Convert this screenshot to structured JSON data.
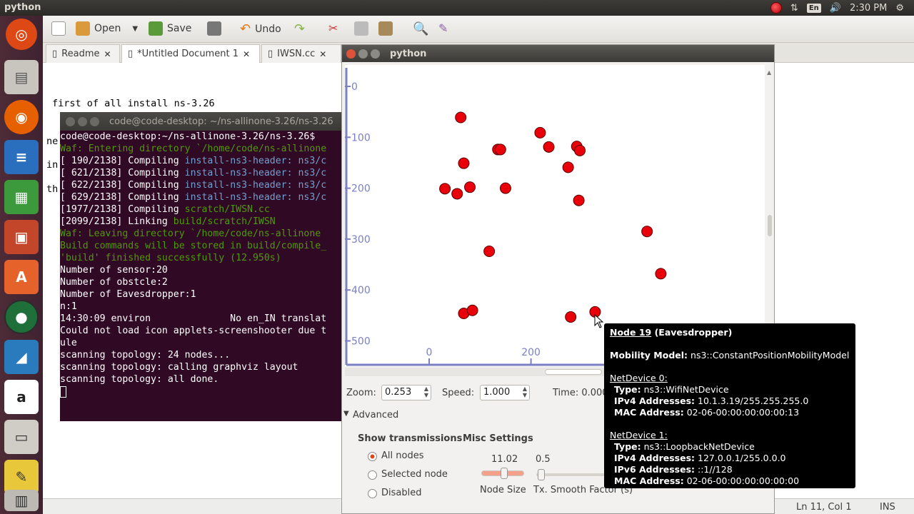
{
  "topbar": {
    "app_title": "python",
    "clock": "2:30 PM",
    "lang": "En"
  },
  "gedit": {
    "toolbar": {
      "open": "Open",
      "save": "Save",
      "undo": "Undo"
    },
    "tabs": [
      "Readme",
      "*Untitled Document 1",
      "IWSN.cc"
    ],
    "editor_lines": [
      "first of all install  ns-3.26",
      "ne",
      "in",
      "th"
    ],
    "status": {
      "position": "Ln 11, Col 1",
      "mode": "INS"
    }
  },
  "terminal": {
    "title": "code@code-desktop: ~/ns-allinone-3.26/ns-3.26",
    "lines": [
      [
        {
          "t": "code@code-desktop:~/ns-allinone-3.26/ns-3.26$ ",
          "c": "w"
        }
      ],
      [
        {
          "t": "Waf: Entering directory `/home/code/ns-allinone",
          "c": "g"
        }
      ],
      [
        {
          "t": "[ 190/2138] Compiling ",
          "c": "w"
        },
        {
          "t": "install-ns3-header: ns3/c",
          "c": "c"
        }
      ],
      [
        {
          "t": "[ 621/2138] Compiling ",
          "c": "w"
        },
        {
          "t": "install-ns3-header: ns3/c",
          "c": "c"
        }
      ],
      [
        {
          "t": "[ 622/2138] Compiling ",
          "c": "w"
        },
        {
          "t": "install-ns3-header: ns3/c",
          "c": "c"
        }
      ],
      [
        {
          "t": "[ 629/2138] Compiling ",
          "c": "w"
        },
        {
          "t": "install-ns3-header: ns3/c",
          "c": "c"
        }
      ],
      [
        {
          "t": "[1977/2138] Compiling ",
          "c": "w"
        },
        {
          "t": "scratch/IWSN.cc",
          "c": "g"
        }
      ],
      [
        {
          "t": "[2099/2138] Linking ",
          "c": "w"
        },
        {
          "t": "build/scratch/IWSN",
          "c": "g"
        }
      ],
      [
        {
          "t": "Waf: Leaving directory `/home/code/ns-allinone",
          "c": "g"
        }
      ],
      [
        {
          "t": "Build commands will be stored in build/compile_",
          "c": "g"
        }
      ],
      [
        {
          "t": "'build' finished successfully (12.950s)",
          "c": "g"
        }
      ],
      [
        {
          "t": "Number of sensor:20",
          "c": "w"
        }
      ],
      [
        {
          "t": "Number of obstcle:2",
          "c": "w"
        }
      ],
      [
        {
          "t": "Number of Eavesdropper:1",
          "c": "w"
        }
      ],
      [
        {
          "t": "n:1",
          "c": "w"
        }
      ],
      [
        {
          "t": "14:30:09 environ              No en_IN translat",
          "c": "w"
        }
      ],
      [
        {
          "t": "Could not load icon applets-screenshooter due t",
          "c": "w"
        }
      ],
      [
        {
          "t": "ule",
          "c": "w"
        }
      ],
      [
        {
          "t": "scanning topology: 24 nodes...",
          "c": "w"
        }
      ],
      [
        {
          "t": "scanning topology: calling graphviz layout",
          "c": "w"
        }
      ],
      [
        {
          "t": "scanning topology: all done.",
          "c": "w"
        }
      ]
    ]
  },
  "python_window": {
    "title": "python",
    "zoom_label": "Zoom:",
    "zoom_value": "0.253",
    "speed_label": "Speed:",
    "speed_value": "1.000",
    "time_label": "Time: 0.000",
    "advanced": "Advanced",
    "show_transmissions": "Show transmissions",
    "misc_settings": "Misc Settings",
    "radio": [
      "All nodes",
      "Selected node",
      "Disabled"
    ],
    "node_size_value": "11.02",
    "node_size_label": "Node Size",
    "smooth_value": "0.5",
    "smooth_label": "Tx. Smooth Factor (s)"
  },
  "chart_data": {
    "type": "scatter",
    "x_ticks": [
      "0",
      "200"
    ],
    "y_ticks": [
      "0",
      "100",
      "200",
      "300",
      "400",
      "500"
    ],
    "points": [
      {
        "x": 62,
        "y": 61
      },
      {
        "x": 135,
        "y": 124
      },
      {
        "x": 140,
        "y": 124
      },
      {
        "x": 218,
        "y": 91
      },
      {
        "x": 235,
        "y": 119
      },
      {
        "x": 273,
        "y": 159
      },
      {
        "x": 290,
        "y": 118
      },
      {
        "x": 296,
        "y": 126
      },
      {
        "x": 68,
        "y": 151
      },
      {
        "x": 31,
        "y": 201
      },
      {
        "x": 55,
        "y": 211
      },
      {
        "x": 80,
        "y": 198
      },
      {
        "x": 150,
        "y": 200
      },
      {
        "x": 294,
        "y": 224
      },
      {
        "x": 428,
        "y": 285
      },
      {
        "x": 455,
        "y": 368
      },
      {
        "x": 118,
        "y": 324
      },
      {
        "x": 68,
        "y": 446
      },
      {
        "x": 85,
        "y": 440
      },
      {
        "x": 278,
        "y": 453
      },
      {
        "x": 326,
        "y": 443
      }
    ],
    "point_color": "#e8000b"
  },
  "tooltip": {
    "title": "Node 19",
    "title_suffix": " (Eavesdropper)",
    "mobility_label": "Mobility Model:",
    "mobility_value": " ns3::ConstantPositionMobilityModel",
    "dev0": "NetDevice 0:",
    "dev0_type_l": "Type:",
    "dev0_type_v": " ns3::WifiNetDevice",
    "dev0_ipv4_l": "IPv4 Addresses:",
    "dev0_ipv4_v": " 10.1.3.19/255.255.255.0",
    "dev0_mac_l": "MAC Address:",
    "dev0_mac_v": " 02-06-00:00:00:00:00:13",
    "dev1": "NetDevice 1:",
    "dev1_type_l": "Type:",
    "dev1_type_v": " ns3::LoopbackNetDevice",
    "dev1_ipv4_l": "IPv4 Addresses:",
    "dev1_ipv4_v": " 127.0.0.1/255.0.0.0",
    "dev1_ipv6_l": "IPv6 Addresses:",
    "dev1_ipv6_v": " ::1//128",
    "dev1_mac_l": "MAC Address:",
    "dev1_mac_v": " 02-06-00:00:00:00:00:00"
  }
}
